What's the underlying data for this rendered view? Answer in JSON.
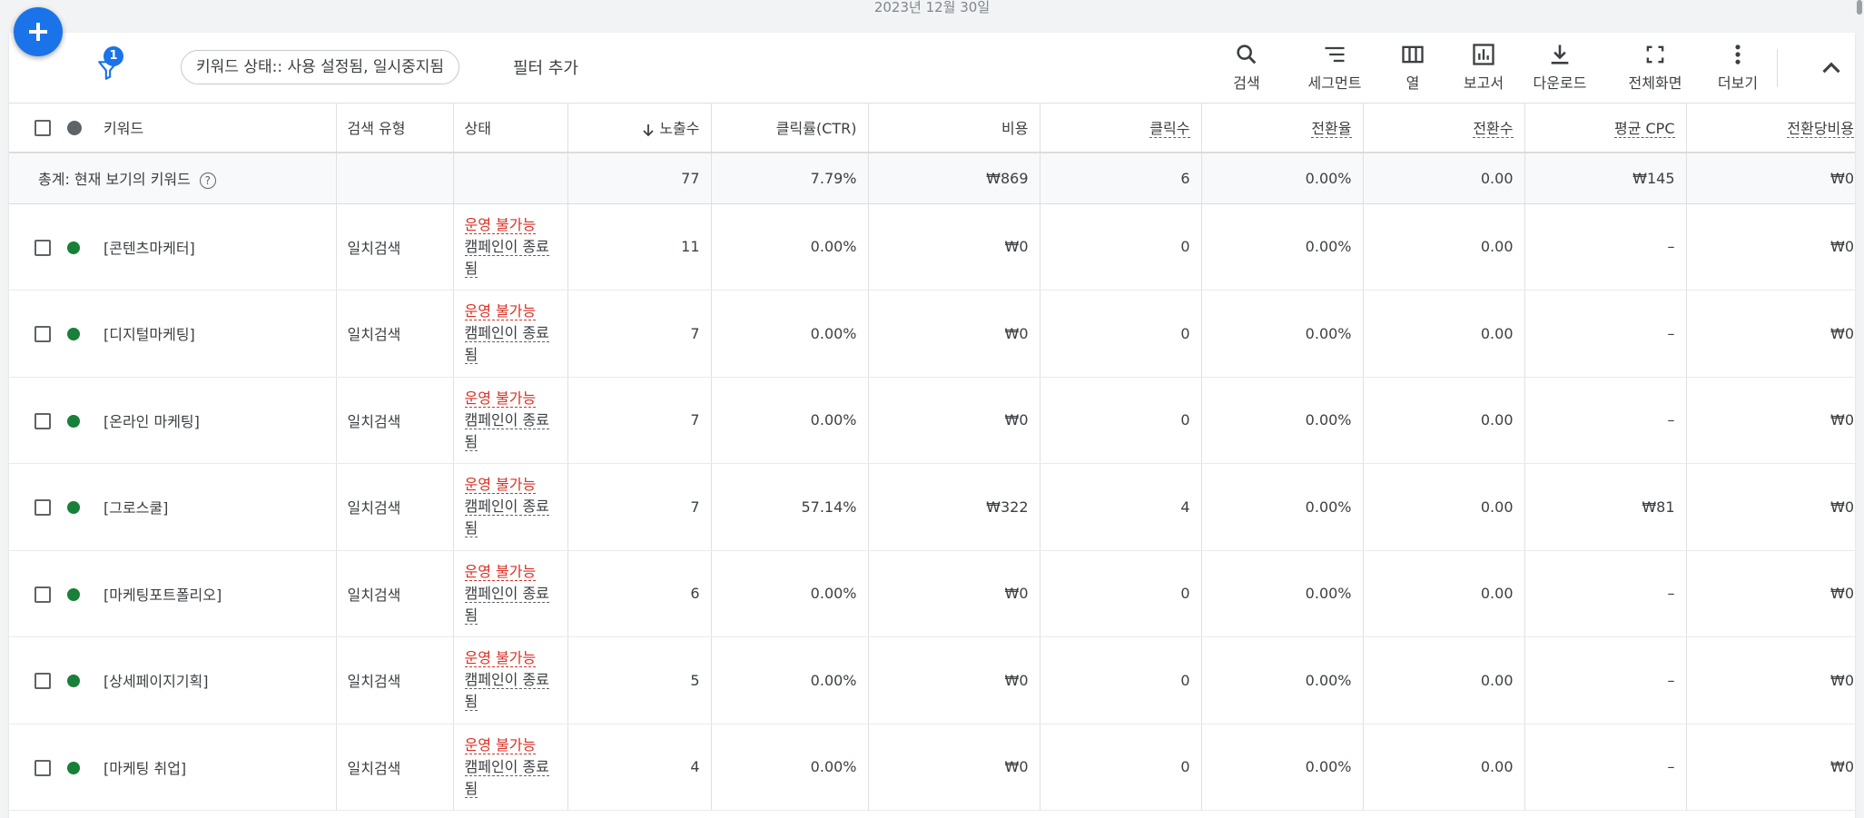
{
  "date_label": "2023년 12월 30일",
  "filter": {
    "badge_count": "1",
    "chip_label": "키워드 상태:: 사용 설정됨, 일시중지됨",
    "add_filter_label": "필터 추가"
  },
  "toolbar": {
    "search": "검색",
    "segment": "세그먼트",
    "columns": "열",
    "report": "보고서",
    "download": "다운로드",
    "fullscreen": "전체화면",
    "more": "더보기"
  },
  "table": {
    "headers": {
      "keyword": "키워드",
      "match_type": "검색 유형",
      "status": "상태",
      "impressions": "노출수",
      "ctr": "클릭률(CTR)",
      "cost": "비용",
      "clicks": "클릭수",
      "conv_rate": "전환율",
      "conversions": "전환수",
      "avg_cpc": "평균 CPC",
      "cost_per_conv": "전환당비용"
    },
    "summary": {
      "label": "총계: 현재 보기의 키워드",
      "impressions": "77",
      "ctr": "7.79%",
      "cost": "₩869",
      "clicks": "6",
      "conv_rate": "0.00%",
      "conversions": "0.00",
      "avg_cpc": "₩145",
      "cost_per_conv": "₩0"
    },
    "rows": [
      {
        "keyword": "[콘텐츠마케터]",
        "match_type": "일치검색",
        "status": "운영 불가능",
        "status_detail": "캠페인이 종료됨",
        "impressions": "11",
        "ctr": "0.00%",
        "cost": "₩0",
        "clicks": "0",
        "conv_rate": "0.00%",
        "conversions": "0.00",
        "avg_cpc": "–",
        "cost_per_conv": "₩0"
      },
      {
        "keyword": "[디지털마케팅]",
        "match_type": "일치검색",
        "status": "운영 불가능",
        "status_detail": "캠페인이 종료됨",
        "impressions": "7",
        "ctr": "0.00%",
        "cost": "₩0",
        "clicks": "0",
        "conv_rate": "0.00%",
        "conversions": "0.00",
        "avg_cpc": "–",
        "cost_per_conv": "₩0"
      },
      {
        "keyword": "[온라인 마케팅]",
        "match_type": "일치검색",
        "status": "운영 불가능",
        "status_detail": "캠페인이 종료됨",
        "impressions": "7",
        "ctr": "0.00%",
        "cost": "₩0",
        "clicks": "0",
        "conv_rate": "0.00%",
        "conversions": "0.00",
        "avg_cpc": "–",
        "cost_per_conv": "₩0"
      },
      {
        "keyword": "[그로스쿨]",
        "match_type": "일치검색",
        "status": "운영 불가능",
        "status_detail": "캠페인이 종료됨",
        "impressions": "7",
        "ctr": "57.14%",
        "cost": "₩322",
        "clicks": "4",
        "conv_rate": "0.00%",
        "conversions": "0.00",
        "avg_cpc": "₩81",
        "cost_per_conv": "₩0"
      },
      {
        "keyword": "[마케팅포트폴리오]",
        "match_type": "일치검색",
        "status": "운영 불가능",
        "status_detail": "캠페인이 종료됨",
        "impressions": "6",
        "ctr": "0.00%",
        "cost": "₩0",
        "clicks": "0",
        "conv_rate": "0.00%",
        "conversions": "0.00",
        "avg_cpc": "–",
        "cost_per_conv": "₩0"
      },
      {
        "keyword": "[상세페이지기획]",
        "match_type": "일치검색",
        "status": "운영 불가능",
        "status_detail": "캠페인이 종료됨",
        "impressions": "5",
        "ctr": "0.00%",
        "cost": "₩0",
        "clicks": "0",
        "conv_rate": "0.00%",
        "conversions": "0.00",
        "avg_cpc": "–",
        "cost_per_conv": "₩0"
      },
      {
        "keyword": "[마케팅 취업]",
        "match_type": "일치검색",
        "status": "운영 불가능",
        "status_detail": "캠페인이 종료됨",
        "impressions": "4",
        "ctr": "0.00%",
        "cost": "₩0",
        "clicks": "0",
        "conv_rate": "0.00%",
        "conversions": "0.00",
        "avg_cpc": "–",
        "cost_per_conv": "₩0"
      }
    ]
  },
  "colors": {
    "accent": "#1a73e8",
    "status_error": "#d93025",
    "status_dot": "#188038"
  }
}
